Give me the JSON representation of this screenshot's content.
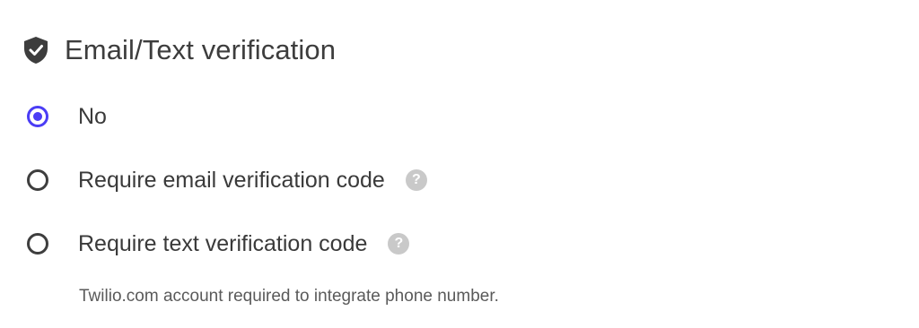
{
  "section": {
    "title": "Email/Text verification",
    "icon": "shield-check-icon"
  },
  "options": [
    {
      "label": "No",
      "checked": true,
      "has_help": false
    },
    {
      "label": "Require email verification code",
      "checked": false,
      "has_help": true,
      "help_glyph": "?"
    },
    {
      "label": "Require text verification code",
      "checked": false,
      "has_help": true,
      "help_glyph": "?"
    }
  ],
  "note": "Twilio.com account required to integrate phone number.",
  "colors": {
    "accent": "#4b3df5",
    "text": "#3a3a3a",
    "help_icon_bg": "#c9c9c9"
  }
}
